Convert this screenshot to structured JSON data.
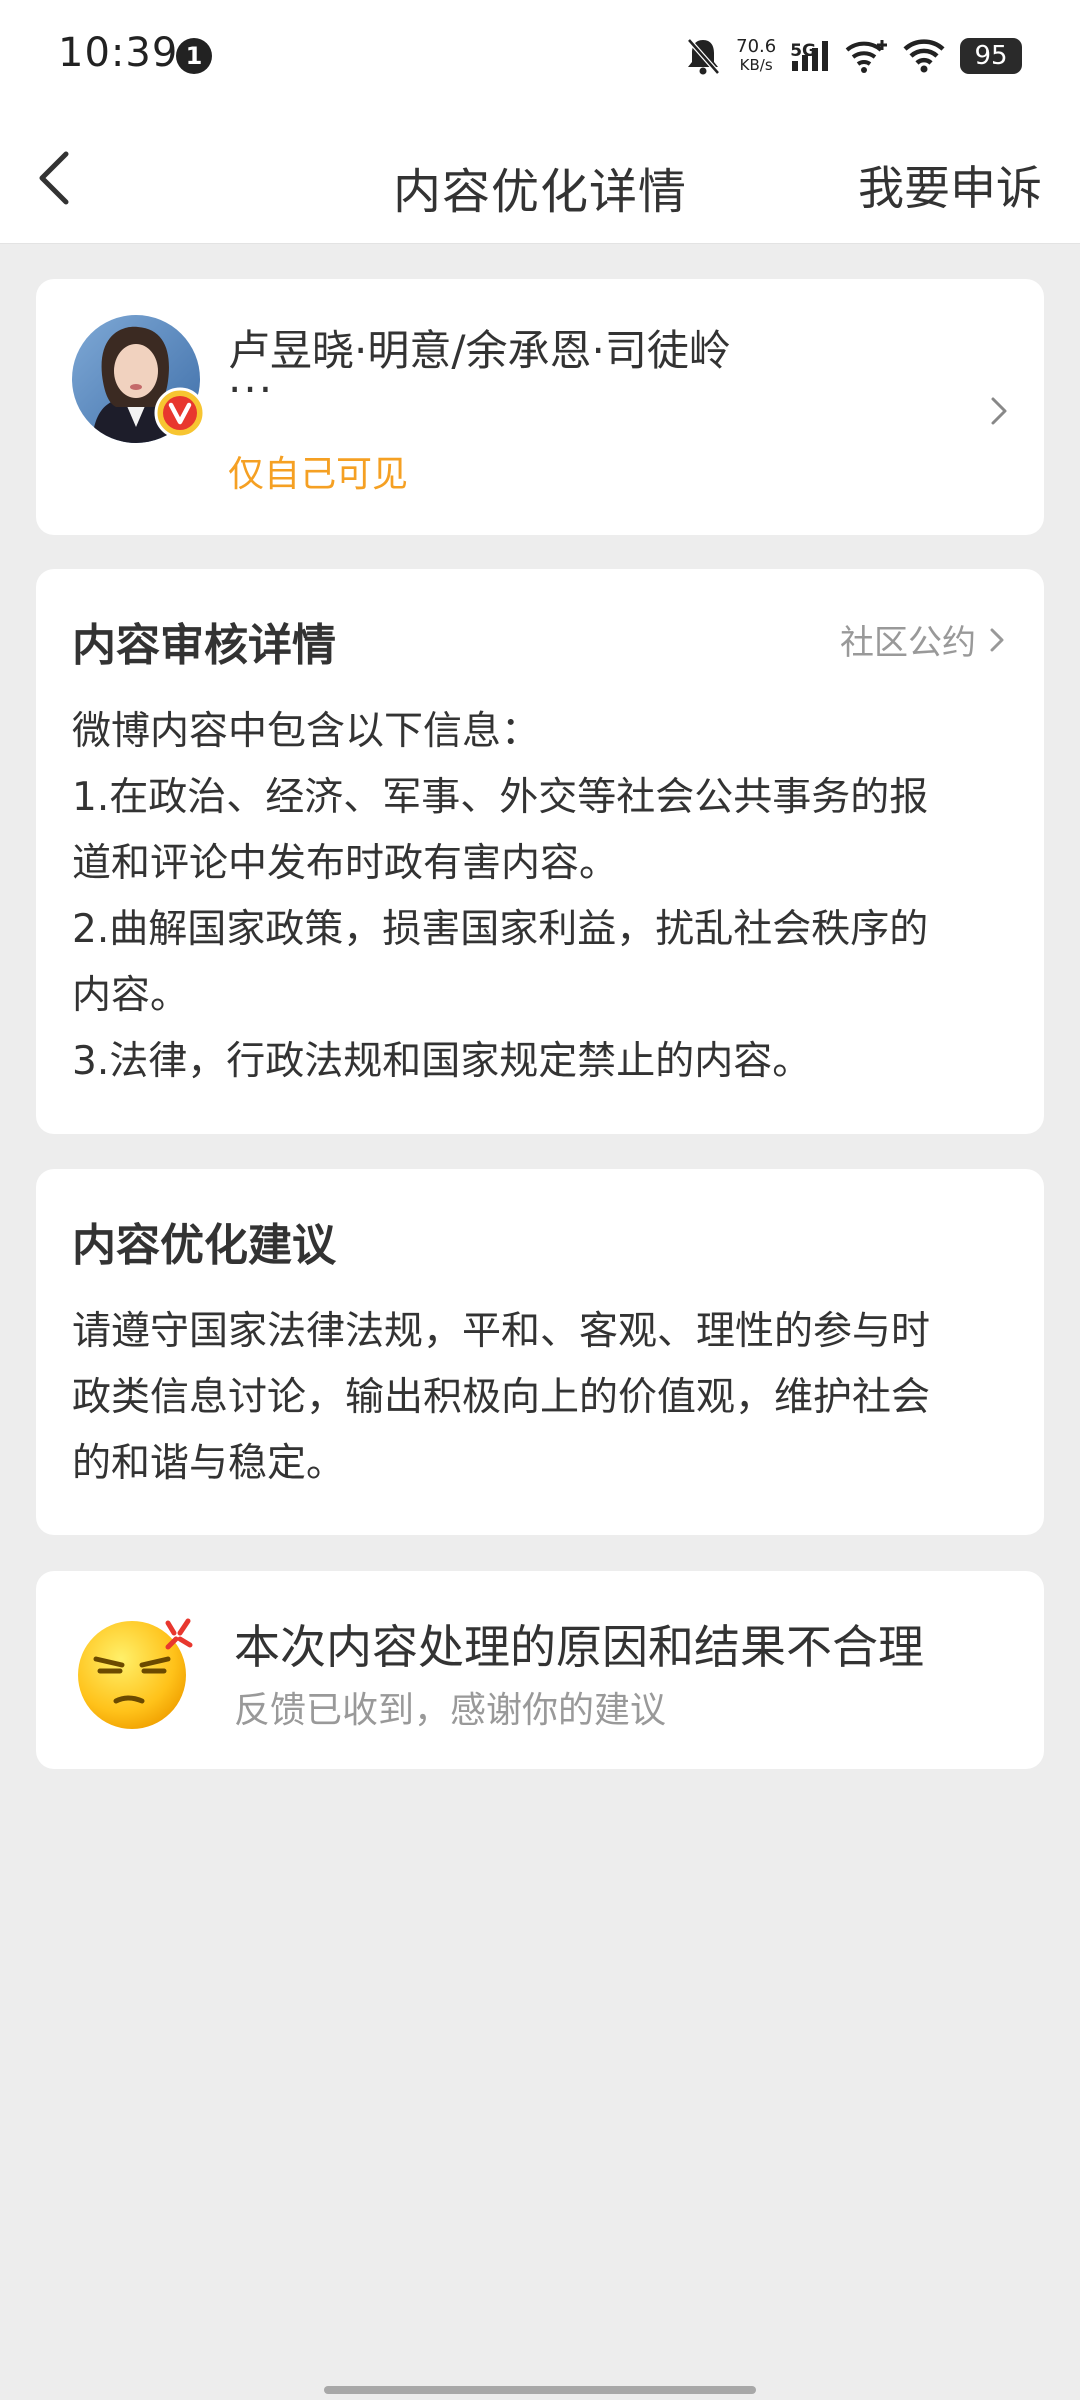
{
  "status_bar": {
    "time": "10:39",
    "notification_count": "1",
    "net_speed_value": "70.6",
    "net_speed_unit": "KB/s",
    "network_type": "5G",
    "battery": "95"
  },
  "nav": {
    "title": "内容优化详情",
    "appeal_label": "我要申诉"
  },
  "user_card": {
    "name": "卢昱晓·明意/余承恩·司徒岭",
    "ellipsis": "···",
    "visibility": "仅自己可见"
  },
  "review": {
    "title": "内容审核详情",
    "community_link": "社区公约",
    "lines": [
      "微博内容中包含以下信息：",
      "1.在政治、经济、军事、外交等社会公共事务的报",
      "道和评论中发布时政有害内容。",
      "2.曲解国家政策，损害国家利益，扰乱社会秩序的",
      "内容。",
      "3.法律，行政法规和国家规定禁止的内容。"
    ]
  },
  "suggestion": {
    "title": "内容优化建议",
    "lines": [
      "请遵守国家法律法规，平和、客观、理性的参与时",
      "政类信息讨论，输出积极向上的价值观，维护社会",
      "的和谐与稳定。"
    ]
  },
  "feedback": {
    "title": "本次内容处理的原因和结果不合理",
    "subtitle": "反馈已收到，感谢你的建议"
  },
  "icons": {
    "back": "chevron-left-icon",
    "user_chevron": "chevron-right-icon",
    "community_chevron": "chevron-right-icon",
    "verified_badge": "verified-v-icon",
    "feedback_emoji": "annoyed-face-icon"
  },
  "colors": {
    "accent_orange": "#f5a023",
    "page_bg": "#ededed",
    "card_bg": "#ffffff",
    "muted_text": "#999999"
  }
}
